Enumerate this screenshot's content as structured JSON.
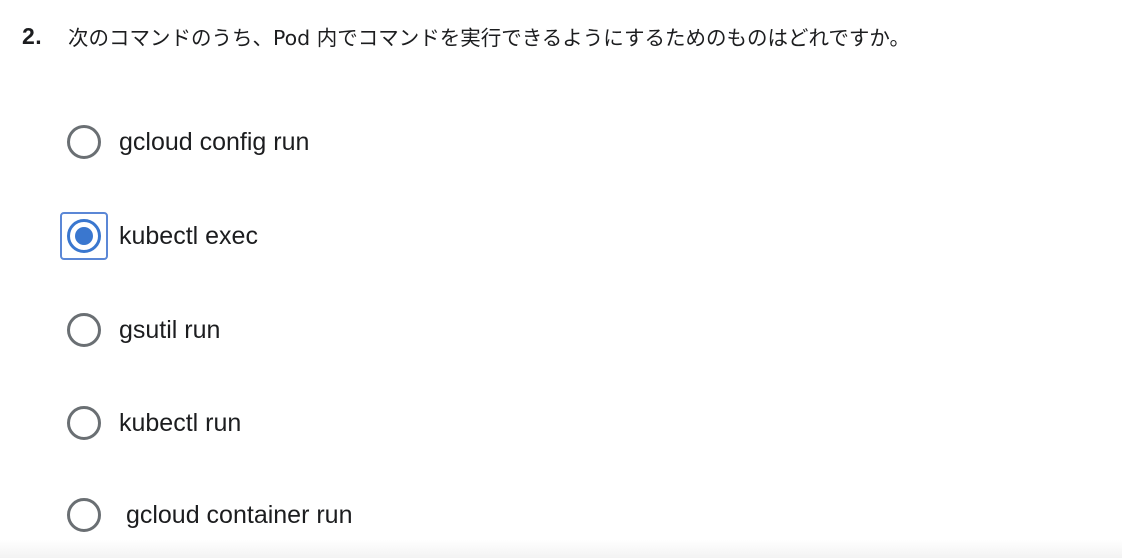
{
  "question": {
    "number": "2.",
    "text": "次のコマンドのうち、Pod 内でコマンドを実行できるようにするためのものはどれですか。"
  },
  "options": [
    {
      "label": "gcloud config run",
      "selected": false
    },
    {
      "label": "kubectl exec",
      "selected": true
    },
    {
      "label": "gsutil run",
      "selected": false
    },
    {
      "label": "kubectl run",
      "selected": false
    },
    {
      "label": " gcloud container run",
      "selected": false
    }
  ],
  "colors": {
    "accent": "#3a77cf",
    "focus_ring": "#5b87d6",
    "radio_border": "#6a6f73",
    "text": "#1c1d1f"
  }
}
